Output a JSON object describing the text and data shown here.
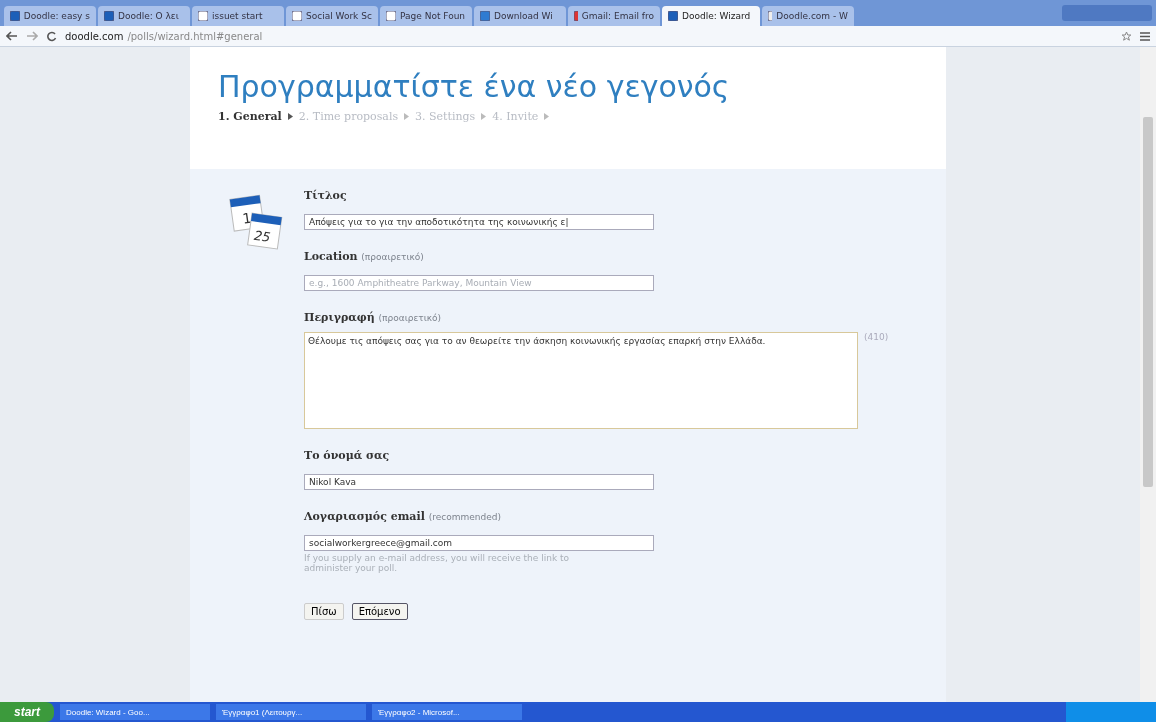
{
  "browser": {
    "tabs": [
      {
        "label": "Doodle: easy s",
        "kind": "doodle",
        "selected": false
      },
      {
        "label": "Doodle: O λει",
        "kind": "doodle",
        "selected": false
      },
      {
        "label": "issuet start",
        "kind": "page",
        "selected": false
      },
      {
        "label": "Social Work Sc",
        "kind": "page",
        "selected": false
      },
      {
        "label": "Page Not Foun",
        "kind": "page",
        "selected": false
      },
      {
        "label": "Download Wi",
        "kind": "download",
        "selected": false
      },
      {
        "label": "Gmail: Email fro",
        "kind": "gmail",
        "selected": false
      },
      {
        "label": "Doodle: Wizard",
        "kind": "doodle",
        "selected": true
      },
      {
        "label": "Doodle.com - W",
        "kind": "wiki",
        "selected": false
      }
    ],
    "url": {
      "host": "doodle.com",
      "path": "/polls/wizard.html#general"
    }
  },
  "page": {
    "title": "Προγραμματίστε ένα νέο γεγονός",
    "calendar_days": [
      "1",
      "25"
    ],
    "steps": [
      {
        "label": "1. General",
        "selected": true
      },
      {
        "label": "2. Time proposals",
        "selected": false
      },
      {
        "label": "3. Settings",
        "selected": false
      },
      {
        "label": "4. Invite",
        "selected": false
      }
    ],
    "fields": [
      {
        "kind": "input",
        "label": "Τίτλος",
        "value": "Απόψεις για το για την αποδοτικότητα της κοινωνικής ε|"
      },
      {
        "kind": "input",
        "label": "Location",
        "note": "(προαιρετικό)",
        "placeholder": "e.g., 1600 Amphitheatre Parkway, Mountain View"
      },
      {
        "kind": "textarea",
        "label": "Περιγραφή",
        "note": "(προαιρετικό)",
        "value": "Θέλουμε τις απόψεις σας για το αν θεωρείτε την άσκηση κοινωνικής εργασίας επαρκή στην Ελλάδα.",
        "counter": "(410)"
      },
      {
        "kind": "input",
        "label": "Το όνομά σας",
        "value": "Nikol Kava"
      },
      {
        "kind": "input",
        "label": "Λογαριασμός email",
        "note": "(recommended)",
        "value": "socialworkergreece@gmail.com",
        "hint": "If you supply an e-mail address, you will receive the link to administer your poll."
      }
    ],
    "buttons": [
      "Πίσω",
      "Επόμενο"
    ]
  },
  "taskbar": {
    "start": "start",
    "items": [
      "Doodle: Wizard - Goo...",
      "Έγγραφο1 (Λειτουργ...",
      "Έγγραφο2 - Microsof..."
    ]
  }
}
